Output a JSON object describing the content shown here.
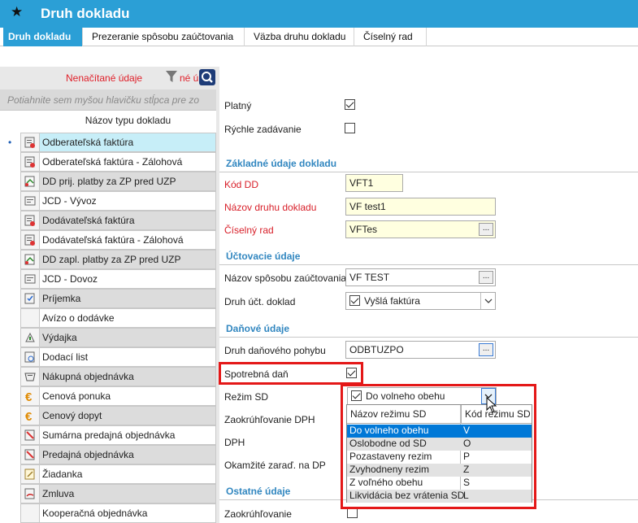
{
  "window": {
    "title": "Druh dokladu",
    "star_icon": "star-icon"
  },
  "tabs": [
    {
      "label": "Druh dokladu",
      "active": true
    },
    {
      "label": "Prezeranie spôsobu zaúčtovania"
    },
    {
      "label": "Väzba druhu dokladu"
    },
    {
      "label": "Číselný rad"
    }
  ],
  "left_panel": {
    "not_loaded": "Nenačítané údaje",
    "filter_fragment": "né ú",
    "group_hint": "Potiahnite sem myšou hlavičku stĺpca pre zo",
    "column_header": "Názov typu dokladu",
    "rows": [
      {
        "label": "Odberateľská faktúra",
        "icon": "invoice-icon",
        "selected": true
      },
      {
        "label": "Odberateľská faktúra - Zálohová",
        "icon": "invoice-icon"
      },
      {
        "label": "DD prij. platby za ZP pred UZP",
        "icon": "payment-icon"
      },
      {
        "label": "JCD - Vývoz",
        "icon": "customs-icon"
      },
      {
        "label": "Dodávateľská faktúra",
        "icon": "invoice-icon"
      },
      {
        "label": "Dodávateľská faktúra - Zálohová",
        "icon": "invoice-icon"
      },
      {
        "label": "DD zapl. platby za ZP pred UZP",
        "icon": "payment-icon"
      },
      {
        "label": "JCD - Dovoz",
        "icon": "customs-icon"
      },
      {
        "label": "Príjemka",
        "icon": "receipt-icon"
      },
      {
        "label": "Avízo o dodávke",
        "icon": ""
      },
      {
        "label": "Výdajka",
        "icon": "issue-icon"
      },
      {
        "label": "Dodací list",
        "icon": "delivery-note-icon"
      },
      {
        "label": "Nákupná objednávka",
        "icon": "purchase-order-icon"
      },
      {
        "label": "Cenová ponuka",
        "icon": "euro-icon"
      },
      {
        "label": "Cenový dopyt",
        "icon": "euro-icon"
      },
      {
        "label": "Sumárna predajná objednávka",
        "icon": "sales-order-icon"
      },
      {
        "label": "Predajná objednávka",
        "icon": "sales-order-icon"
      },
      {
        "label": "Žiadanka",
        "icon": "request-icon"
      },
      {
        "label": "Zmluva",
        "icon": "contract-icon"
      },
      {
        "label": "Kooperačná objednávka",
        "icon": ""
      }
    ]
  },
  "form": {
    "platny": {
      "label": "Platný",
      "checked": true
    },
    "rychle": {
      "label": "Rýchle zadávanie",
      "checked": false
    },
    "sec_basic": "Základné údaje dokladu",
    "kod_dd": {
      "label": "Kód DD",
      "value": "VFT1"
    },
    "nazov_druhu": {
      "label": "Názov druhu dokladu",
      "value": "VF test1"
    },
    "ciselny_rad": {
      "label": "Číselný rad",
      "value": "VFTes",
      "button": "..."
    },
    "sec_accounting": "Účtovacie údaje",
    "nazov_sposobu": {
      "label": "Názov spôsobu zaúčtovania",
      "value": "VF TEST",
      "button": "..."
    },
    "druh_uct": {
      "label": "Druh účt. doklad",
      "value": "Vyšlá faktúra",
      "checked": true
    },
    "sec_tax": "Daňové údaje",
    "druh_danoveho": {
      "label": "Druh daňového pohybu",
      "value": "ODBTUZPO",
      "button": "..."
    },
    "spotrebna": {
      "label": "Spotrebná daň",
      "checked": true
    },
    "rezim_sd": {
      "label": "Režim SD",
      "value": "Do volneho obehu",
      "checked": true
    },
    "zaokruhlovanie_dph": {
      "label": "Zaokrúhľovanie DPH"
    },
    "dph": {
      "label": "DPH"
    },
    "okamzite": {
      "label": "Okamžité zaraď. na DP"
    },
    "sec_other": "Ostatné údaje",
    "zaokruhlovanie": {
      "label": "Zaokrúhľovanie",
      "checked": false
    }
  },
  "rezim_grid": {
    "headers": [
      "Názov režimu SD",
      "Kód režimu SD"
    ],
    "rows": [
      {
        "name": "Do volneho obehu",
        "code": "V",
        "selected": true
      },
      {
        "name": "Oslobodne od SD",
        "code": "O"
      },
      {
        "name": "Pozastaveny rezim",
        "code": "P"
      },
      {
        "name": "Zvyhodneny rezim",
        "code": "Z"
      },
      {
        "name": "Z voľného obehu",
        "code": "S"
      },
      {
        "name": "Likvidácia bez vrátenia SD",
        "code": "L"
      }
    ]
  }
}
